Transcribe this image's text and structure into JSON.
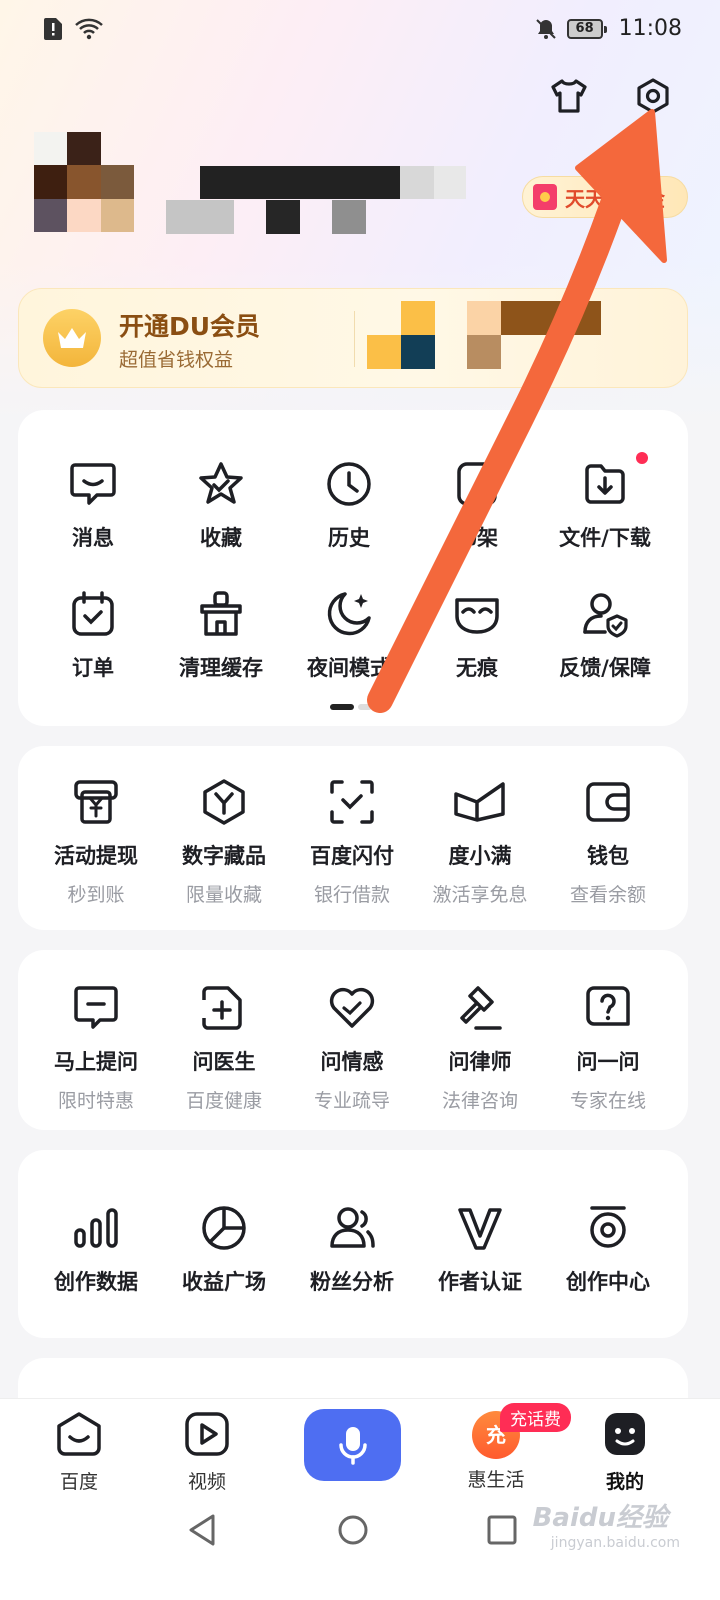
{
  "status_bar": {
    "time": "11:08",
    "battery": "68"
  },
  "header": {
    "wardrobe_icon": "tshirt-icon",
    "settings_icon": "gear-icon"
  },
  "profile": {
    "coin_pill_label": "天天领现金"
  },
  "vip": {
    "title": "开通DU会员",
    "subtitle": "超值省钱权益"
  },
  "tools": {
    "row1": [
      {
        "label": "消息",
        "icon": "message-icon"
      },
      {
        "label": "收藏",
        "icon": "star-icon"
      },
      {
        "label": "历史",
        "icon": "clock-icon"
      },
      {
        "label": "书架",
        "icon": "bookshelf-icon"
      },
      {
        "label": "文件/下载",
        "icon": "download-icon"
      }
    ],
    "row2": [
      {
        "label": "订单",
        "icon": "calendar-check-icon"
      },
      {
        "label": "清理缓存",
        "icon": "clean-icon"
      },
      {
        "label": "夜间模式",
        "icon": "moon-icon"
      },
      {
        "label": "无痕",
        "icon": "mask-icon"
      },
      {
        "label": "反馈/保障",
        "icon": "user-shield-icon"
      }
    ]
  },
  "finance": [
    {
      "label": "活动提现",
      "sub": "秒到账"
    },
    {
      "label": "数字藏品",
      "sub": "限量收藏"
    },
    {
      "label": "百度闪付",
      "sub": "银行借款"
    },
    {
      "label": "度小满",
      "sub": "激活享免息"
    },
    {
      "label": "钱包",
      "sub": "查看余额"
    }
  ],
  "ask": [
    {
      "label": "马上提问",
      "sub": "限时特惠"
    },
    {
      "label": "问医生",
      "sub": "百度健康"
    },
    {
      "label": "问情感",
      "sub": "专业疏导"
    },
    {
      "label": "问律师",
      "sub": "法律咨询"
    },
    {
      "label": "问一问",
      "sub": "专家在线"
    }
  ],
  "creator": [
    {
      "label": "创作数据"
    },
    {
      "label": "收益广场"
    },
    {
      "label": "粉丝分析"
    },
    {
      "label": "作者认证"
    },
    {
      "label": "创作中心"
    }
  ],
  "bottom_nav": {
    "items": [
      {
        "label": "百度"
      },
      {
        "label": "视频"
      },
      {
        "label": "惠生活"
      },
      {
        "label": "我的"
      }
    ],
    "promo_badge": "充话费",
    "promo_icon_text": "充"
  },
  "watermark": {
    "text": "Baidu经验",
    "url_text": "jingyan.baidu.com"
  },
  "colors": {
    "accent": "#4e6ef2",
    "annotation_arrow": "#f4683c",
    "badge": "#ff2d55"
  }
}
